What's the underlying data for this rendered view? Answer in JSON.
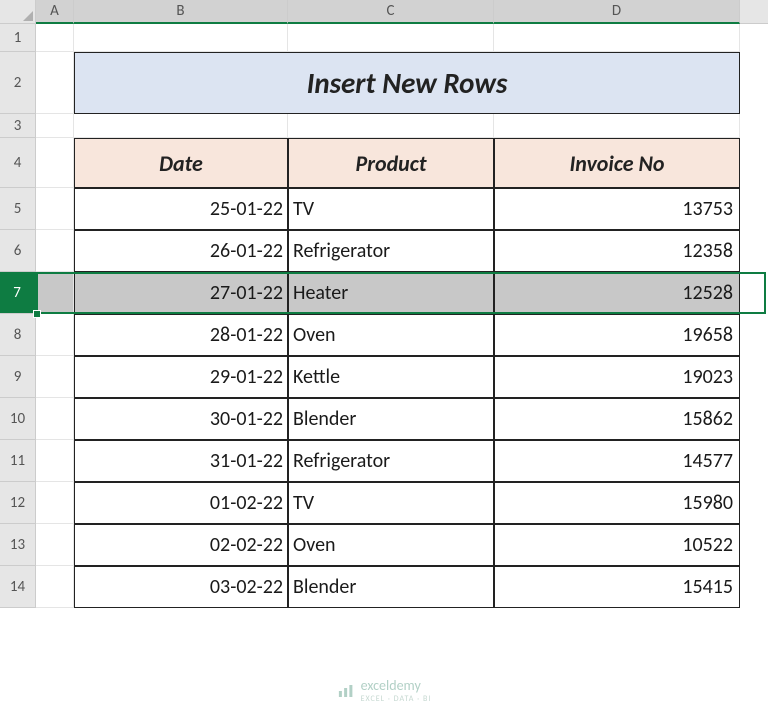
{
  "columns": [
    "A",
    "B",
    "C",
    "D"
  ],
  "row_numbers": [
    "1",
    "2",
    "3",
    "4",
    "5",
    "6",
    "7",
    "8",
    "9",
    "10",
    "11",
    "12",
    "13",
    "14"
  ],
  "title": "Insert New Rows",
  "headers": {
    "b": "Date",
    "c": "Product",
    "d": "Invoice No"
  },
  "rows": [
    {
      "date": "25-01-22",
      "product": "TV",
      "invoice": "13753"
    },
    {
      "date": "26-01-22",
      "product": "Refrigerator",
      "invoice": "12358"
    },
    {
      "date": "27-01-22",
      "product": "Heater",
      "invoice": "12528"
    },
    {
      "date": "28-01-22",
      "product": "Oven",
      "invoice": "19658"
    },
    {
      "date": "29-01-22",
      "product": "Kettle",
      "invoice": "19023"
    },
    {
      "date": "30-01-22",
      "product": "Blender",
      "invoice": "15862"
    },
    {
      "date": "31-01-22",
      "product": "Refrigerator",
      "invoice": "14577"
    },
    {
      "date": "01-02-22",
      "product": "TV",
      "invoice": "15980"
    },
    {
      "date": "02-02-22",
      "product": "Oven",
      "invoice": "10522"
    },
    {
      "date": "03-02-22",
      "product": "Blender",
      "invoice": "15415"
    }
  ],
  "selected_row_index": 2,
  "watermark": {
    "brand": "exceldemy",
    "tag": "EXCEL · DATA · BI"
  }
}
